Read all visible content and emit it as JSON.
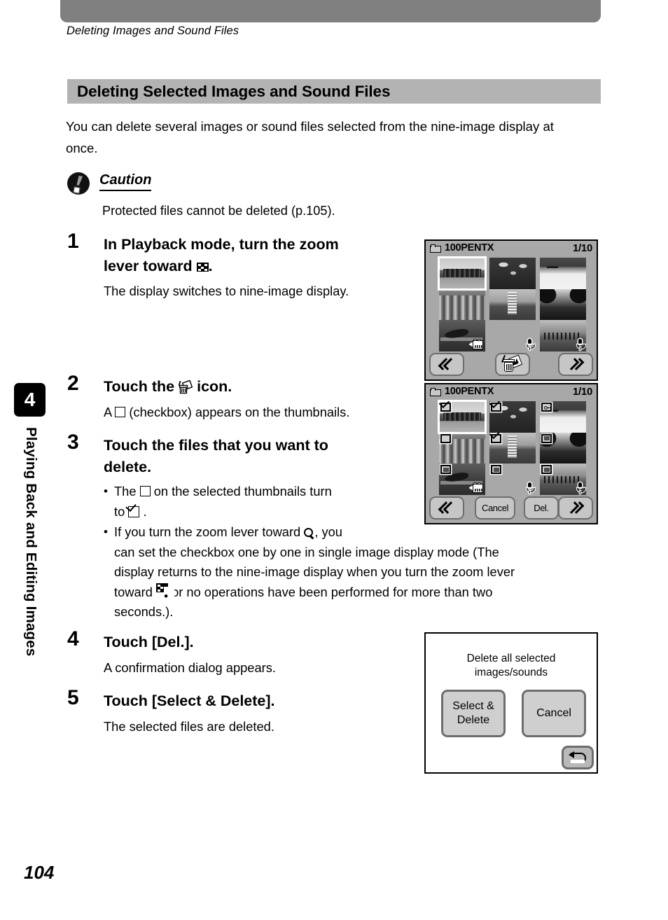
{
  "page": {
    "running_head": "Deleting Images and Sound Files",
    "number": "104"
  },
  "sidebar": {
    "chapter_number": "4",
    "chapter_title": "Playing Back and Editing Images"
  },
  "section": {
    "heading": "Deleting Selected Images and Sound Files",
    "intro": "You can delete several images or sound files selected from the nine-image display at once."
  },
  "caution": {
    "title": "Caution",
    "body": "Protected files cannot be deleted (p.105)."
  },
  "steps": [
    {
      "number": "1",
      "title_a": "In Playback mode, turn the zoom",
      "title_b": "lever toward",
      "title_c": ".",
      "desc": "The display switches to nine-image display."
    },
    {
      "number": "2",
      "title_a": "Touch the",
      "title_b": "icon.",
      "desc_a": "A",
      "desc_b": "(checkbox) appears on the thumbnails."
    },
    {
      "number": "3",
      "title_a": "Touch the files that you want to",
      "title_b": "delete.",
      "bullet1_a": "The",
      "bullet1_b": "on the selected thumbnails turn",
      "bullet1_c": "to",
      "bullet1_d": ".",
      "bullet2_a": "If you turn the zoom lever toward",
      "bullet2_b": ", you",
      "bullet2_c": "can set the checkbox one by one in single image display mode (The",
      "bullet2_d": "display returns to the nine-image display when you turn the zoom lever",
      "bullet2_e": "toward",
      "bullet2_f": "or no operations have been performed for more than two",
      "bullet2_g": "seconds.)."
    },
    {
      "number": "4",
      "title_a": "Touch [Del.].",
      "desc": "A confirmation dialog appears."
    },
    {
      "number": "5",
      "title_a": "Touch [Select & Delete].",
      "desc": "The selected files are deleted."
    }
  ],
  "screen_nine_image": {
    "folder": "100PENTX",
    "counter": "1/10",
    "thumbnails": [
      {
        "id": "skyline",
        "selected": true,
        "badge": "none"
      },
      {
        "id": "city",
        "selected": false,
        "badge": "none"
      },
      {
        "id": "whale",
        "selected": false,
        "badge": "movie-icon"
      },
      {
        "id": "palms",
        "selected": false,
        "badge": "none"
      },
      {
        "id": "tower",
        "selected": false,
        "badge": "none"
      },
      {
        "id": "empty",
        "selected": false,
        "badge": "mic-icon"
      },
      {
        "id": "beach",
        "selected": false,
        "badge": "none"
      },
      {
        "id": "road",
        "selected": false,
        "badge": "none"
      },
      {
        "id": "pier",
        "selected": false,
        "badge": "mic-icon"
      }
    ],
    "toolbar": {
      "prev_icon": "chevron-left-icon",
      "delete_icon": "trash-icon",
      "next_icon": "chevron-right-icon"
    }
  },
  "screen_select_files": {
    "folder": "100PENTX",
    "counter": "1/10",
    "thumbnails": [
      {
        "id": "skyline",
        "selected": true,
        "checkbox": "checked",
        "badge": "none"
      },
      {
        "id": "city",
        "selected": false,
        "checkbox": "empty",
        "badge": "none"
      },
      {
        "id": "whale",
        "selected": false,
        "checkbox": "filled",
        "badge": "movie-icon"
      },
      {
        "id": "palms",
        "selected": false,
        "checkbox": "checked",
        "badge": "none"
      },
      {
        "id": "tower",
        "selected": false,
        "checkbox": "checked",
        "badge": "none"
      },
      {
        "id": "empty",
        "selected": false,
        "checkbox": "filled",
        "badge": "mic-icon"
      },
      {
        "id": "beach",
        "selected": false,
        "checkbox": "protected",
        "badge": "none"
      },
      {
        "id": "road",
        "selected": false,
        "checkbox": "filled",
        "badge": "none"
      },
      {
        "id": "pier",
        "selected": false,
        "checkbox": "filled",
        "badge": "mic-icon"
      }
    ],
    "toolbar": {
      "prev_icon": "chevron-left-icon",
      "cancel_label": "Cancel",
      "delete_label": "Del.",
      "next_icon": "chevron-right-icon"
    }
  },
  "screen_confirm_dialog": {
    "message_line1": "Delete all selected",
    "message_line2": "images/sounds",
    "select_delete_line1": "Select &",
    "select_delete_line2": "Delete",
    "cancel_label": "Cancel",
    "back_icon": "back-arrow-icon"
  },
  "colors": {
    "top_bar": "#808080",
    "heading_band": "#b3b3b3",
    "screen_bg": "#a8a8a8",
    "button_face": "#c6c6c6",
    "button_border": "#6d6d6d"
  }
}
